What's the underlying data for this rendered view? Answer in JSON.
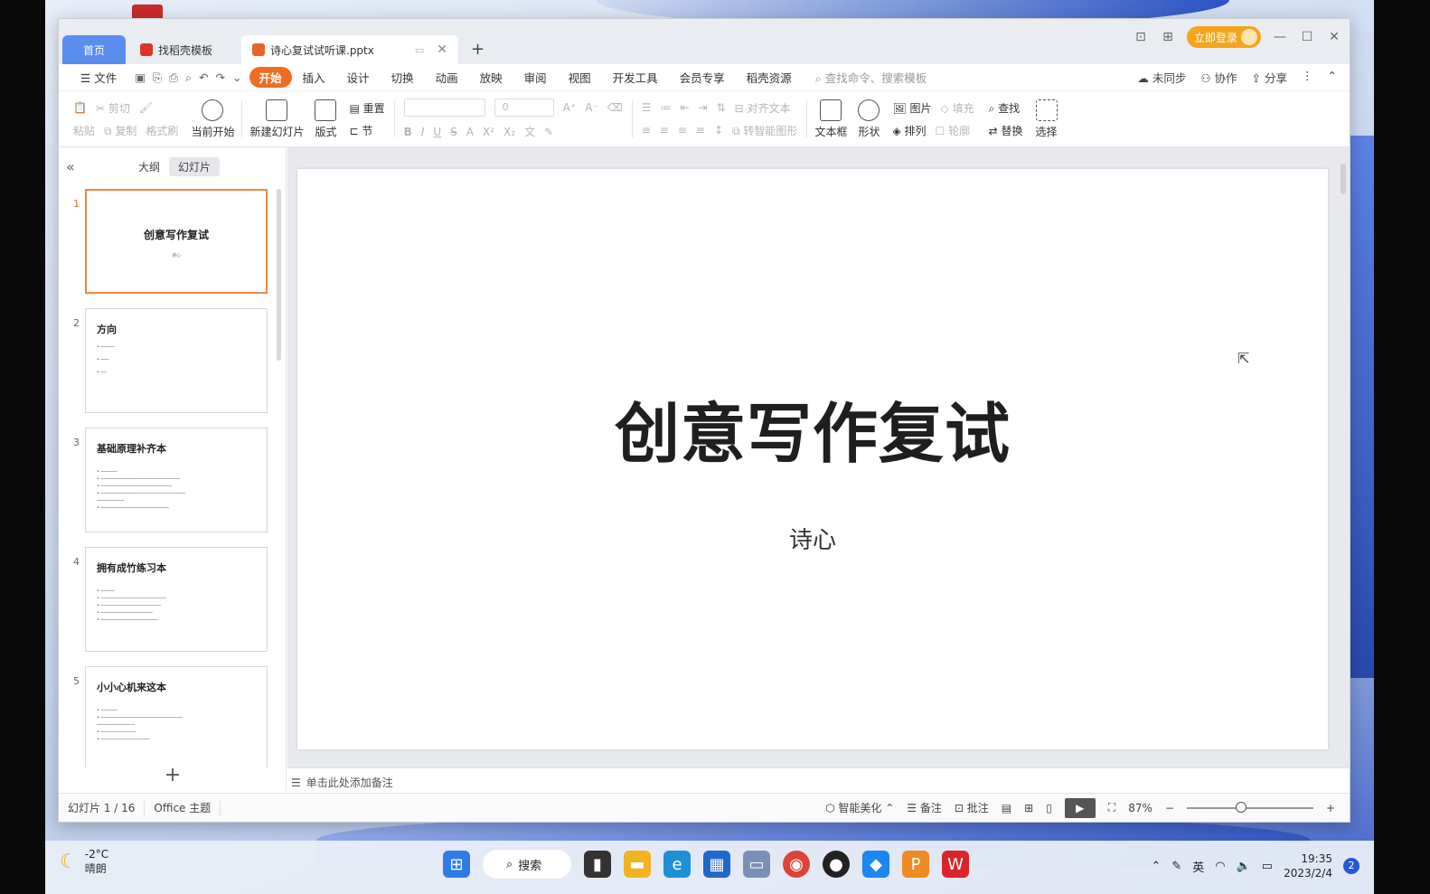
{
  "tabs": {
    "home": "首页",
    "template": "找稻壳模板",
    "document": "诗心复试试听课.pptx",
    "new_tab": "+"
  },
  "titlebar": {
    "login": "立即登录"
  },
  "menu": {
    "file": "文件",
    "items": [
      "开始",
      "插入",
      "设计",
      "切换",
      "动画",
      "放映",
      "审阅",
      "视图",
      "开发工具",
      "会员专享",
      "稻壳资源"
    ],
    "search_placeholder": "查找命令、搜索模板",
    "right": [
      "未同步",
      "协作",
      "分享"
    ]
  },
  "ribbon": {
    "paste": "粘贴",
    "cut": "剪切",
    "copy": "复制",
    "format_painter": "格式刷",
    "start_from_current": "当前开始",
    "new_slide": "新建幻灯片",
    "layout": "版式",
    "section": "节",
    "reset": "重置",
    "font_size": "0",
    "align_text": "对齐文本",
    "smartart": "转智能图形",
    "textbox": "文本框",
    "shape": "形状",
    "picture": "图片",
    "arrange": "排列",
    "fill": "填充",
    "outline": "轮廓",
    "find": "查找",
    "replace": "替换",
    "select": "选择"
  },
  "panel": {
    "outline_tab": "大纲",
    "slides_tab": "幻灯片",
    "add": "+"
  },
  "thumbnails": [
    {
      "num": "1",
      "title": "创意写作复试"
    },
    {
      "num": "2",
      "title": "方向"
    },
    {
      "num": "3",
      "title": "基础原理补齐本"
    },
    {
      "num": "4",
      "title": "拥有成竹练习本"
    },
    {
      "num": "5",
      "title": "小小心机来这本"
    }
  ],
  "slide": {
    "title": "创意写作复试",
    "subtitle": "诗心"
  },
  "notes_placeholder": "单击此处添加备注",
  "status": {
    "slide_info": "幻灯片 1 / 16",
    "theme": "Office 主题",
    "beautify": "智能美化",
    "notes": "备注",
    "comments": "批注",
    "zoom": "87%"
  },
  "taskbar": {
    "temp": "-2°C",
    "weather": "晴朗",
    "search": "搜索",
    "lang": "英",
    "time": "19:35",
    "date": "2023/2/4",
    "notifications": "2"
  }
}
